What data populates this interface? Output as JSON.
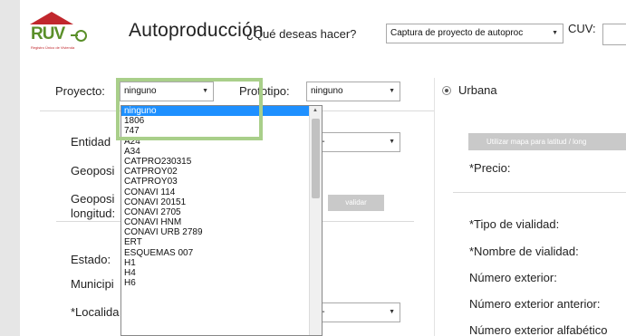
{
  "header": {
    "logo_text": "RUV",
    "logo_tagline": "Registro Único de Vivienda",
    "title": "Autoproducción",
    "question": "¿Qué deseas hacer?",
    "action_select_value": "Captura de proyecto de autoproc",
    "cuv_label": "CUV:"
  },
  "form": {
    "proyecto_label": "Proyecto:",
    "proyecto_value": "ninguno",
    "prototipo_label": "Prototipo:",
    "prototipo_value": "ninguno",
    "entidad_label": "Entidad",
    "entidad_select_partial": "A --",
    "geoposi1_label": "Geoposi",
    "geoposi2_label": "Geoposi",
    "longitud_label": "longitud:",
    "validar_label": "validar",
    "estado_label": "Estado:",
    "municipio_label": "Municipi",
    "localidad_label": "*Localida",
    "localidad_select_partial": "A --"
  },
  "right": {
    "urbana_label": "Urbana",
    "mapa_button": "Utilizar mapa para latitud / long",
    "precio_label": "*Precio:",
    "tipo_vialidad_label": "*Tipo de vialidad:",
    "nombre_vialidad_label": "*Nombre de vialidad:",
    "numero_exterior_label": "Número exterior:",
    "numero_exterior_anterior_label": "Número exterior anterior:",
    "numero_exterior_alfabetico_label": "Número exterior alfabético"
  },
  "dropdown": {
    "items": [
      "ninguno",
      "1806",
      "747",
      "A24",
      "A34",
      "CATPRO230315",
      "CATPROY02",
      "CATPROY03",
      "CONAVI 114",
      "CONAVI 20151",
      "CONAVI 2705",
      "CONAVI HNM",
      "CONAVI URB 2789",
      "ERT",
      "ESQUEMAS 007",
      "H1",
      "H4",
      "H6"
    ],
    "selected": "ninguno"
  }
}
